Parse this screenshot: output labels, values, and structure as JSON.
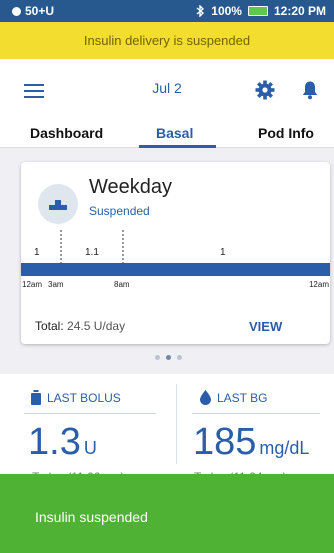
{
  "status_bar": {
    "carrier": "50+U",
    "battery": "100%",
    "time": "12:20 PM",
    "bluetooth_icon": "bluetooth-icon"
  },
  "banner": {
    "text": "Insulin delivery is suspended",
    "color": "#f3dd2f"
  },
  "header": {
    "date": "Jul 2",
    "menu_icon": "menu-icon",
    "settings_icon": "gear-icon",
    "notifications_icon": "bell-icon"
  },
  "tabs": [
    {
      "label": "Dashboard",
      "active": false
    },
    {
      "label": "Basal",
      "active": true
    },
    {
      "label": "Pod Info",
      "active": false
    }
  ],
  "basal_card": {
    "title": "Weekday",
    "status": "Suspended",
    "chart": {
      "segment_labels": [
        "1",
        "1.1",
        "1"
      ],
      "tick_labels": [
        "12am",
        "3am",
        "8am",
        "12am"
      ]
    },
    "total_label": "Total:",
    "total_value": "24.5 U/day",
    "view_label": "VIEW"
  },
  "pager": {
    "count": 3,
    "active": 1
  },
  "last_bolus": {
    "label": "LAST BOLUS",
    "value": "1.3",
    "unit": "U",
    "time": "Today (11:00 am)"
  },
  "last_bg": {
    "label": "LAST BG",
    "value": "185",
    "unit": "mg/dL",
    "time": "Today (11:04 am)"
  },
  "toast": {
    "text": "Insulin suspended",
    "color": "#4fb235"
  },
  "colors": {
    "primary": "#2a5eaa",
    "status_bar": "#27598e"
  }
}
